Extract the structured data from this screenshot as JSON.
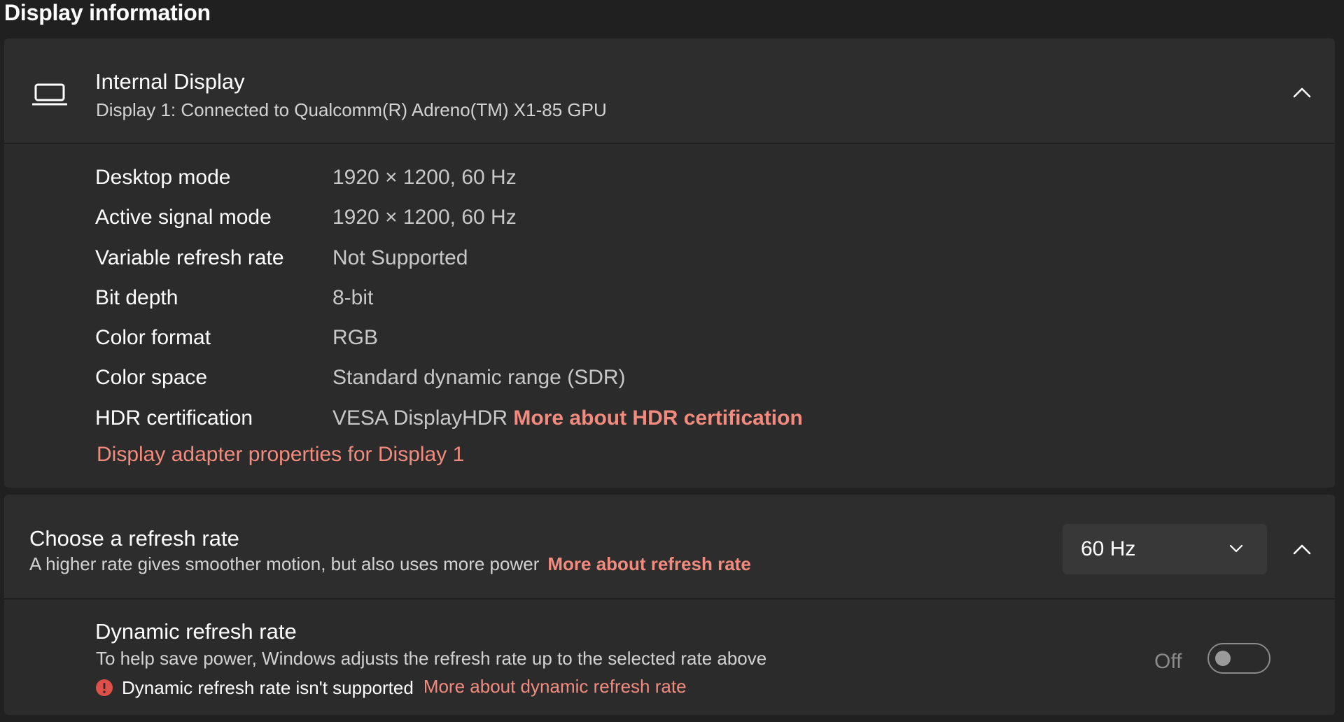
{
  "section_heading": "Display information",
  "display_card": {
    "title": "Internal Display",
    "subtitle": "Display 1: Connected to Qualcomm(R) Adreno(TM) X1-85 GPU",
    "icon": "laptop-icon",
    "expanded": true,
    "rows": [
      {
        "label": "Desktop mode",
        "value": "1920 × 1200, 60 Hz"
      },
      {
        "label": "Active signal mode",
        "value": "1920 × 1200, 60 Hz"
      },
      {
        "label": "Variable refresh rate",
        "value": "Not Supported"
      },
      {
        "label": "Bit depth",
        "value": "8-bit"
      },
      {
        "label": "Color format",
        "value": "RGB"
      },
      {
        "label": "Color space",
        "value": "Standard dynamic range (SDR)"
      },
      {
        "label": "HDR certification",
        "value": "VESA DisplayHDR",
        "link": "More about HDR certification"
      }
    ],
    "adapter_link": "Display adapter properties for Display 1"
  },
  "refresh_card": {
    "title": "Choose a refresh rate",
    "subtitle": "A higher rate gives smoother motion, but also uses more power",
    "subtitle_link": "More about refresh rate",
    "dropdown_value": "60 Hz",
    "expanded": true,
    "dynamic": {
      "title": "Dynamic refresh rate",
      "description": "To help save power, Windows adjusts the refresh rate up to the selected rate above",
      "status_text": "Dynamic refresh rate isn't supported",
      "status_link": "More about dynamic refresh rate",
      "toggle_label": "Off",
      "toggle_on": false
    }
  },
  "colors": {
    "background": "#202020",
    "card": "#2b2b2b",
    "accent_link": "#f28b7e",
    "error": "#e0504a"
  }
}
